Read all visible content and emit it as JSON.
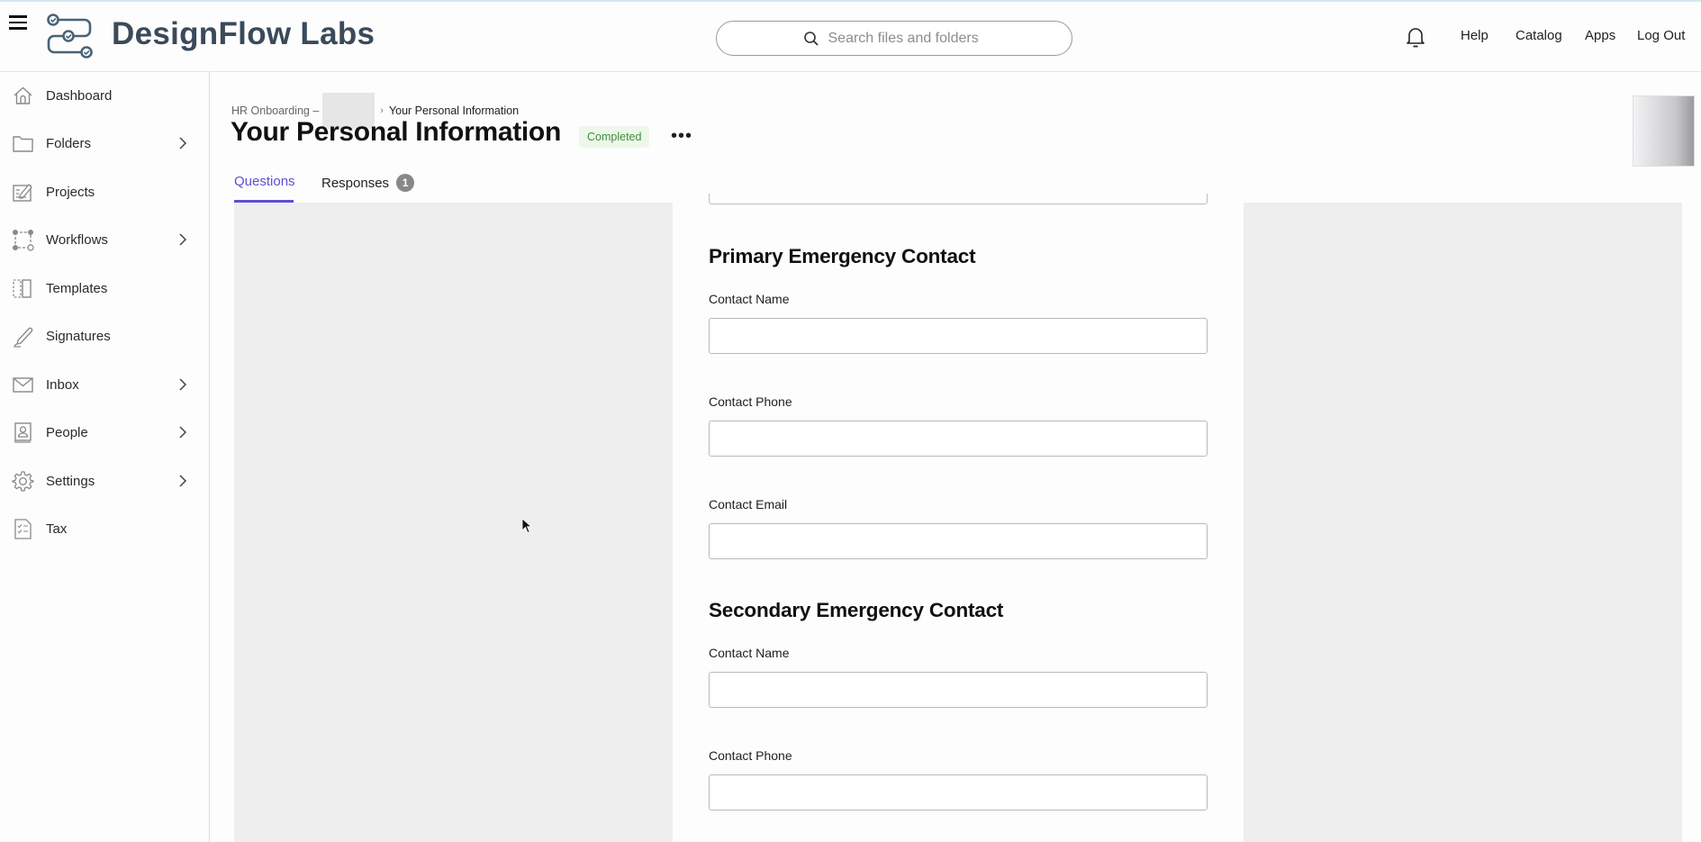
{
  "app": {
    "brand": "DesignFlow Labs",
    "accent_color": "#5b4fd6",
    "brand_color": "#3b4a5a"
  },
  "header": {
    "menu_icon": "hamburger-menu-icon",
    "logo_icon": "workflow-logo-icon",
    "search": {
      "placeholder": "Search files and folders",
      "value": "",
      "icon": "search-icon"
    },
    "notification_icon": "bell-icon",
    "links": [
      "Help",
      "Catalog",
      "Apps",
      "Log Out"
    ]
  },
  "sidebar": {
    "items": [
      {
        "label": "Dashboard",
        "icon": "home-icon",
        "expandable": false
      },
      {
        "label": "Folders",
        "icon": "folder-icon",
        "expandable": true
      },
      {
        "label": "Projects",
        "icon": "projects-icon",
        "expandable": false
      },
      {
        "label": "Workflows",
        "icon": "workflows-icon",
        "expandable": true
      },
      {
        "label": "Templates",
        "icon": "templates-icon",
        "expandable": false
      },
      {
        "label": "Signatures",
        "icon": "pen-icon",
        "expandable": false
      },
      {
        "label": "Inbox",
        "icon": "mail-icon",
        "expandable": true
      },
      {
        "label": "People",
        "icon": "contact-book-icon",
        "expandable": true
      },
      {
        "label": "Settings",
        "icon": "gear-icon",
        "expandable": true
      },
      {
        "label": "Tax",
        "icon": "tax-document-icon",
        "expandable": false
      }
    ]
  },
  "page": {
    "breadcrumb": {
      "parent": "HR Onboarding –",
      "separator": "›",
      "current": "Your Personal Information"
    },
    "title": "Your Personal Information",
    "status": "Completed",
    "status_color": "#3f8f3a",
    "more_label": "•••",
    "tabs": [
      {
        "label": "Questions",
        "active": true
      },
      {
        "label": "Responses",
        "active": false,
        "count": "1"
      }
    ]
  },
  "form": {
    "sections": [
      {
        "heading": "Primary Emergency Contact",
        "fields": [
          {
            "label": "Contact Name",
            "value": ""
          },
          {
            "label": "Contact Phone",
            "value": ""
          },
          {
            "label": "Contact Email",
            "value": ""
          }
        ]
      },
      {
        "heading": "Secondary Emergency Contact",
        "fields": [
          {
            "label": "Contact Name",
            "value": ""
          },
          {
            "label": "Contact Phone",
            "value": ""
          }
        ]
      }
    ]
  }
}
